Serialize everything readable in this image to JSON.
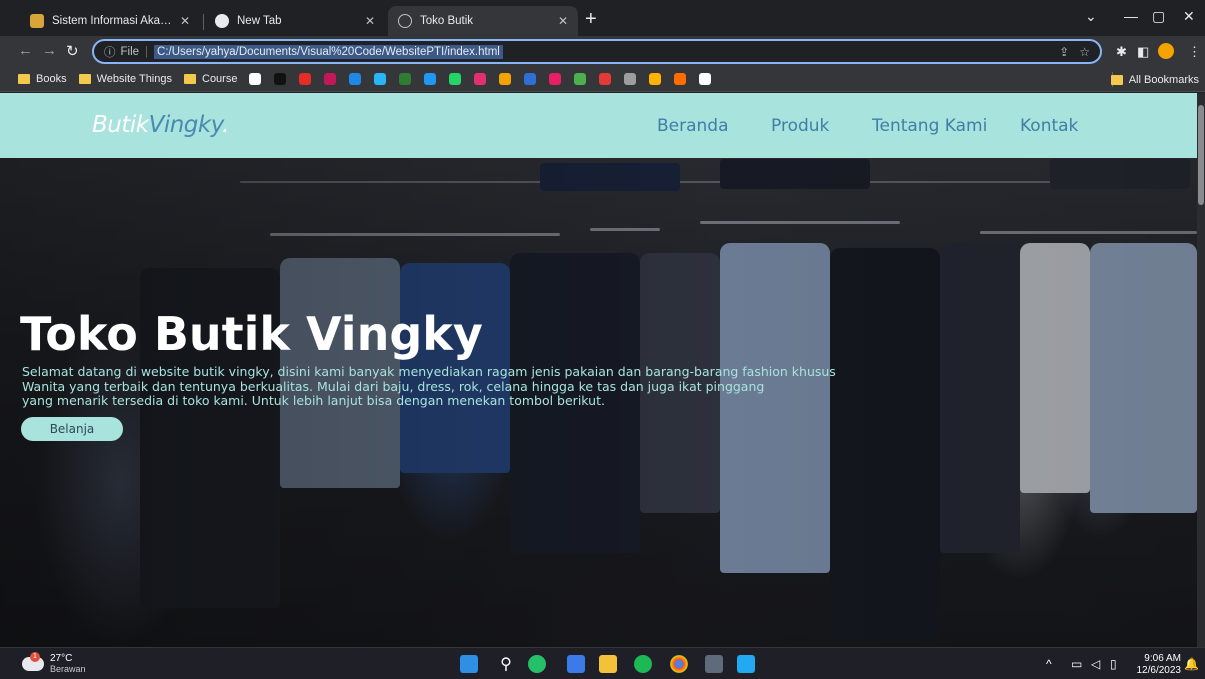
{
  "browser": {
    "tabs": [
      {
        "title": "Sistem Informasi Akademik Mah",
        "active": false
      },
      {
        "title": "New Tab",
        "active": false
      },
      {
        "title": "Toko Butik",
        "active": true
      }
    ],
    "address": {
      "prefix": "File",
      "url": "C:/Users/yahya/Documents/Visual%20Code/WebsitePTI/index.html"
    },
    "bookmarks": [
      {
        "label": "Books",
        "type": "folder"
      },
      {
        "label": "Website Things",
        "type": "folder"
      },
      {
        "label": "Course",
        "type": "folder"
      }
    ],
    "bookmark_icons": [
      "#ffffff",
      "#111111",
      "#e52d27",
      "#c2185b",
      "#1e88e5",
      "#29b6f6",
      "#2e7d32",
      "#2196f3",
      "#25d366",
      "#e1306c",
      "#f4a300",
      "#2f6fd6",
      "#e91e63",
      "#4caf50",
      "#e53935",
      "#9e9e9e",
      "#ffb300",
      "#ff6d00",
      "#ffffff"
    ],
    "all_bookmarks": "All Bookmarks"
  },
  "site": {
    "logo": {
      "part1": "Butik",
      "part2": "Vingky",
      "dot": "."
    },
    "menu": [
      "Beranda",
      "Produk",
      "Tentang Kami",
      "Kontak"
    ],
    "hero": {
      "title": "Toko Butik Vingky",
      "text_line1": "Selamat datang di website butik vingky, disini kami banyak menyediakan ragam jenis pakaian dan barang-barang fashion khusus",
      "text_line2": "Wanita yang terbaik dan tentunya berkualitas. Mulai dari baju, dress, rok, celana hingga ke tas dan juga ikat pinggang",
      "text_line3": "yang menarik tersedia di toko kami. Untuk lebih lanjut bisa dengan menekan tombol berikut.",
      "button": "Belanja"
    },
    "colors": {
      "nav_bg": "#a8e3dd",
      "accent": "#3f7fa6"
    }
  },
  "taskbar": {
    "weather": {
      "temp": "27°C",
      "desc": "Berawan",
      "alert": "1"
    },
    "time": "9:06 AM",
    "date": "12/6/2023"
  }
}
